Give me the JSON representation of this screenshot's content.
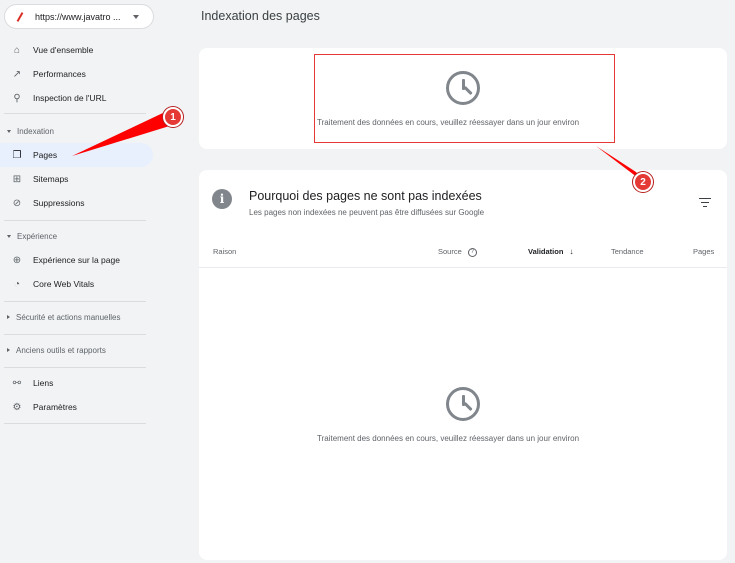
{
  "property": {
    "url": "https://www.javatro ..."
  },
  "sidebar": {
    "items": [
      {
        "label": "Vue d'ensemble",
        "icon": "home-icon"
      },
      {
        "label": "Performances",
        "icon": "trending-up-icon"
      },
      {
        "label": "Inspection de l'URL",
        "icon": "search-icon"
      }
    ],
    "sections": {
      "indexation": "Indexation",
      "experience": "Expérience",
      "securite": "Sécurité et actions manuelles",
      "anciens": "Anciens outils et rapports"
    },
    "indexation_items": [
      {
        "label": "Pages",
        "icon": "pages-icon"
      },
      {
        "label": "Sitemaps",
        "icon": "sitemap-icon"
      },
      {
        "label": "Suppressions",
        "icon": "visibility-off-icon"
      }
    ],
    "experience_items": [
      {
        "label": "Expérience sur la page",
        "icon": "add-circle-icon"
      },
      {
        "label": "Core Web Vitals",
        "icon": "gauge-icon"
      }
    ],
    "bottom_items": [
      {
        "label": "Liens",
        "icon": "links-icon"
      },
      {
        "label": "Paramètres",
        "icon": "gear-icon"
      }
    ]
  },
  "main": {
    "title": "Indexation des pages",
    "processing_message": "Traitement des données en cours, veuillez réessayer dans un jour environ",
    "section": {
      "title": "Pourquoi des pages ne sont pas indexées",
      "subtitle": "Les pages non indexées ne peuvent pas être diffusées sur Google",
      "columns": [
        "Raison",
        "Source",
        "Validation",
        "Tendance",
        "Pages"
      ]
    }
  },
  "annotations": {
    "badge1": "1",
    "badge2": "2"
  },
  "colors": {
    "accent": "#e53935",
    "active_bg": "#e8f0fe"
  }
}
